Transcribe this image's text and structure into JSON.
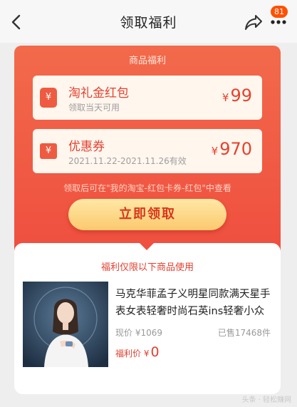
{
  "header": {
    "title": "领取福利",
    "badge_count": "81",
    "back_icon": "chevron-left-icon",
    "share_icon": "share-icon",
    "more_icon": "more-dots-icon"
  },
  "welfare_card": {
    "heading": "商品福利",
    "coupons": [
      {
        "title": "淘礼金红包",
        "subtitle": "领取当天可用",
        "currency": "¥",
        "amount": "99",
        "icon": "red-envelope-icon",
        "icon_glyph": "¥"
      },
      {
        "title": "优惠券",
        "subtitle": "2021.11.22-2021.11.26有效",
        "currency": "¥",
        "amount": "970",
        "icon": "coupon-ticket-icon",
        "icon_glyph": "¥"
      }
    ],
    "note": "领取后可在\"我的淘宝-红包卡券-红包\"中查看",
    "claim_button": "立即领取"
  },
  "product": {
    "heading": "福利仅限以下商品使用",
    "title": "马克华菲孟子义明星同款满天星手表女表轻奢时尚石英ins轻奢小众",
    "original_price": "现价 ¥1069",
    "sold": "已售17468件",
    "welfare_label": "福利价 ¥",
    "welfare_amount": "0"
  },
  "watermark": "头条 · 轻松赚网"
}
